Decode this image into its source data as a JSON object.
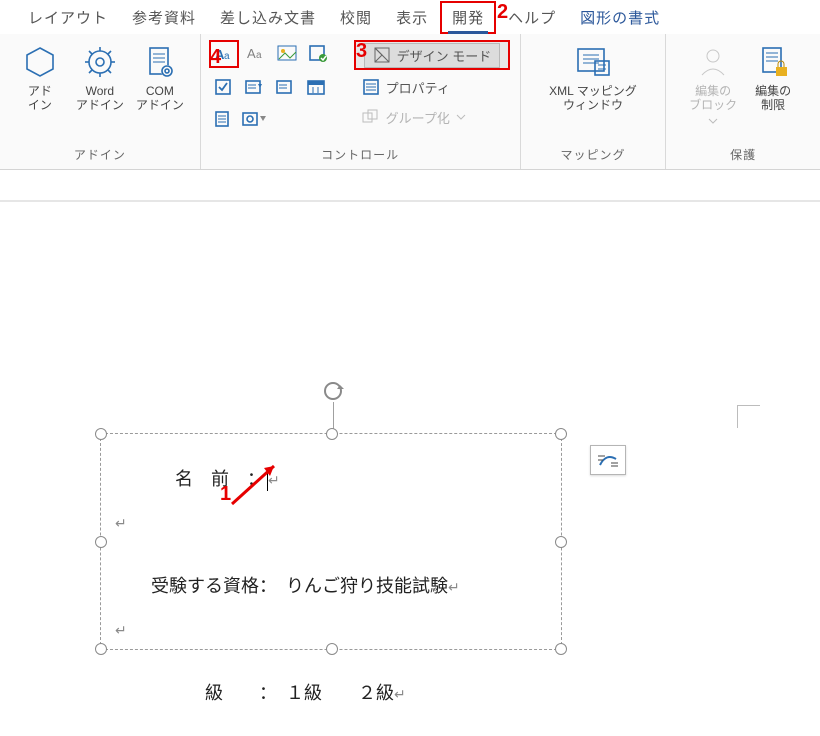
{
  "tabs": {
    "layout": "レイアウト",
    "ref": "参考資料",
    "mailmerge": "差し込み文書",
    "review": "校閲",
    "view": "表示",
    "developer": "開発",
    "help": "ヘルプ",
    "shapefmt": "図形の書式"
  },
  "ribbon": {
    "addins": {
      "addin": "アド\nイン",
      "wordaddin": "Word\nアドイン",
      "comaddin": "COM\nアドイン",
      "group": "アドイン"
    },
    "controls": {
      "design": "デザイン モード",
      "properties": "プロパティ",
      "group": "グループ化",
      "section": "コントロール"
    },
    "mapping": {
      "xmlmap": "XML マッピング\nウィンドウ",
      "group": "マッピング"
    },
    "protect": {
      "block": "編集の\nブロック",
      "restrict": "編集の\n制限",
      "group": "保護"
    }
  },
  "callouts": {
    "c1": "1",
    "c2": "2",
    "c3": "3",
    "c4": "4"
  },
  "doc": {
    "name_label": "名　前　：",
    "qual_label": "受験する資格：",
    "qual_value": "りんご狩り技能試験",
    "grade_label": "級　　：",
    "grade_a": "１級",
    "grade_b": "２級"
  }
}
